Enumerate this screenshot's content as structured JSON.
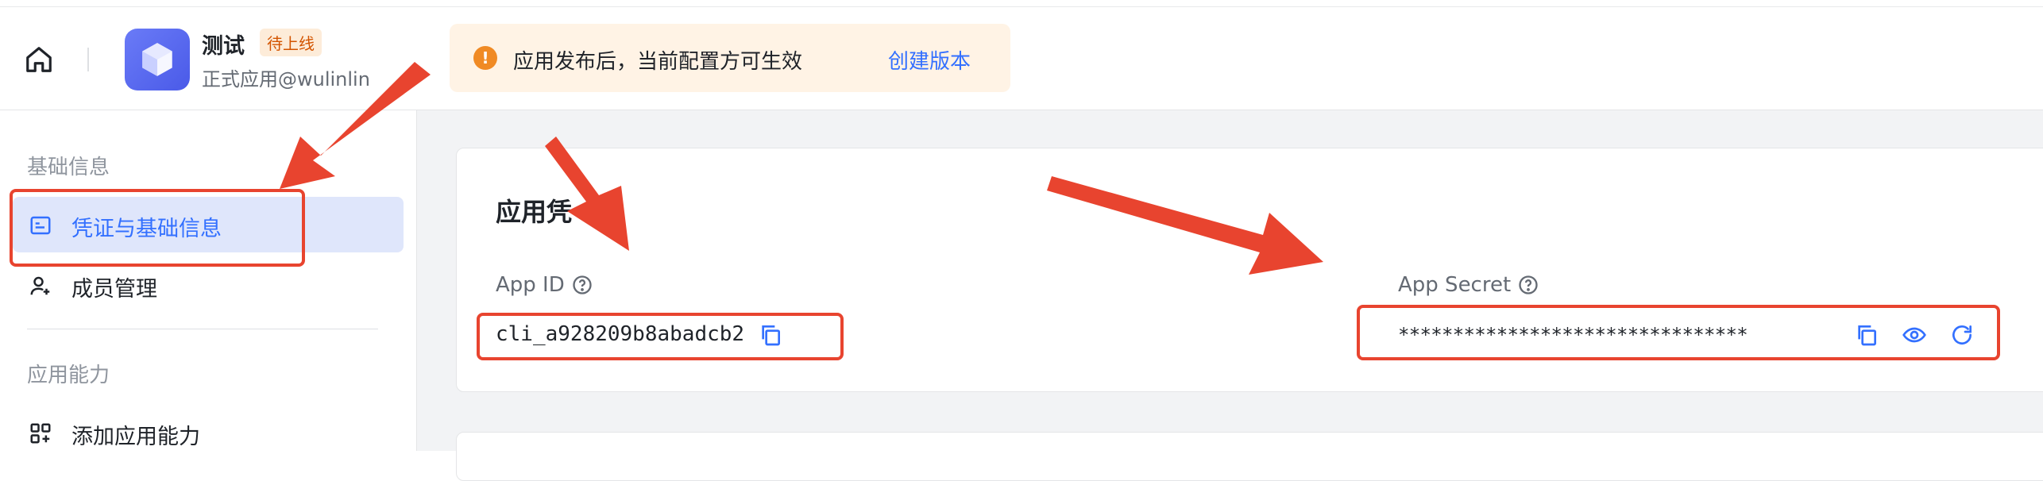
{
  "header": {
    "app_name": "测试",
    "status_badge": "待上线",
    "app_subtitle": "正式应用@wulinlin"
  },
  "banner": {
    "message": "应用发布后，当前配置方可生效",
    "link": "创建版本"
  },
  "sidebar": {
    "sections": [
      {
        "title": "基础信息",
        "items": [
          {
            "label": "凭证与基础信息",
            "icon": "credential-card-icon",
            "active": true
          },
          {
            "label": "成员管理",
            "icon": "user-add-icon",
            "active": false
          }
        ]
      },
      {
        "title": "应用能力",
        "items": [
          {
            "label": "添加应用能力",
            "icon": "apps-grid-add-icon",
            "active": false
          }
        ]
      }
    ]
  },
  "credentials": {
    "title": "应用凭",
    "app_id_label": "App ID",
    "app_id_value": "cli_a928209b8abadcb2",
    "app_secret_label": "App Secret",
    "app_secret_value": "********************************"
  },
  "colors": {
    "accent": "#3370ff",
    "annotation": "#e8442f",
    "warning": "#f08a24",
    "active_bg": "#dfe6fb"
  }
}
